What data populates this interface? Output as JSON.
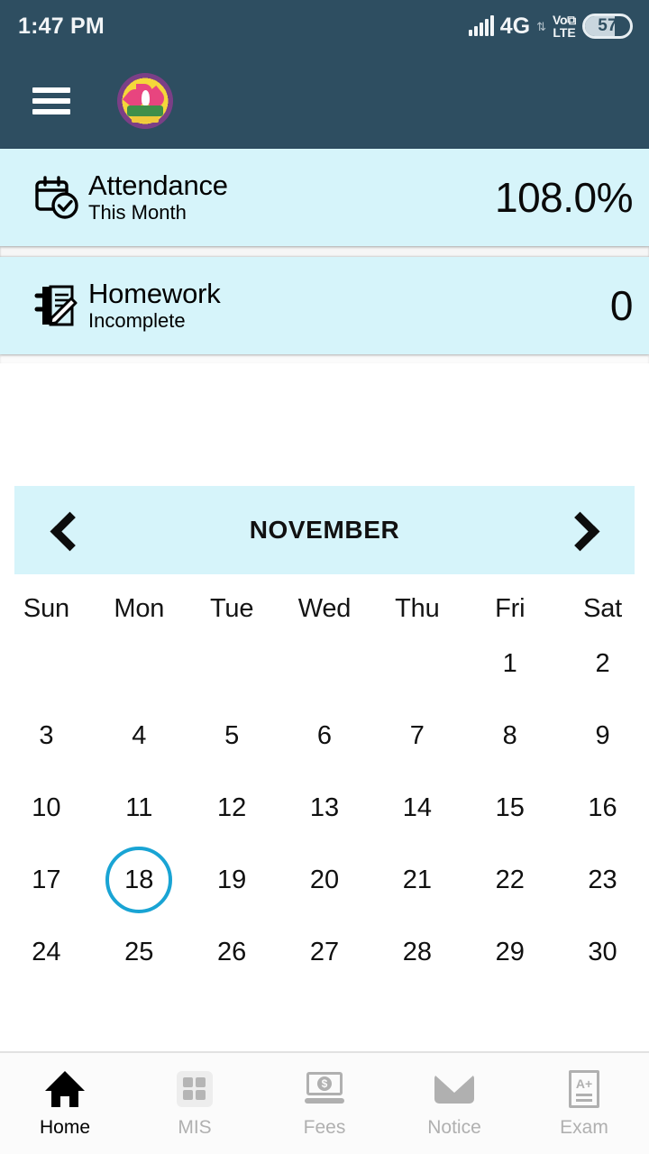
{
  "status_bar": {
    "time": "1:47 PM",
    "network_type": "4G",
    "data_arrows": "⇅",
    "volte_top": "Vo⧉",
    "volte_bottom": "LTE",
    "battery_level": "57"
  },
  "app_bar": {
    "menu_icon": "hamburger-menu-icon",
    "logo_icon": "school-logo"
  },
  "cards": [
    {
      "icon": "calendar-check-icon",
      "title": "Attendance",
      "subtitle": "This Month",
      "value": "108.0%"
    },
    {
      "icon": "notebook-pencil-icon",
      "title": "Homework",
      "subtitle": "Incomplete",
      "value": "0"
    }
  ],
  "calendar": {
    "prev_icon": "chevron-left-icon",
    "next_icon": "chevron-right-icon",
    "month": "NOVEMBER",
    "weekdays": [
      "Sun",
      "Mon",
      "Tue",
      "Wed",
      "Thu",
      "Fri",
      "Sat"
    ],
    "selected_day": "18",
    "selection_color": "#19a4d4",
    "weeks": [
      [
        "",
        "",
        "",
        "",
        "",
        "1",
        "2"
      ],
      [
        "3",
        "4",
        "5",
        "6",
        "7",
        "8",
        "9"
      ],
      [
        "10",
        "11",
        "12",
        "13",
        "14",
        "15",
        "16"
      ],
      [
        "17",
        "18",
        "19",
        "20",
        "21",
        "22",
        "23"
      ],
      [
        "24",
        "25",
        "26",
        "27",
        "28",
        "29",
        "30"
      ]
    ]
  },
  "bottom_nav": {
    "active": "Home",
    "items": [
      {
        "label": "Home",
        "icon": "home-icon"
      },
      {
        "label": "MIS",
        "icon": "grid-icon"
      },
      {
        "label": "Fees",
        "icon": "money-icon"
      },
      {
        "label": "Notice",
        "icon": "envelope-icon"
      },
      {
        "label": "Exam",
        "icon": "exam-document-icon"
      }
    ]
  },
  "theme": {
    "app_bar_color": "#2e4e61",
    "card_color": "#d6f4fa",
    "accent_color": "#19a4d4"
  }
}
